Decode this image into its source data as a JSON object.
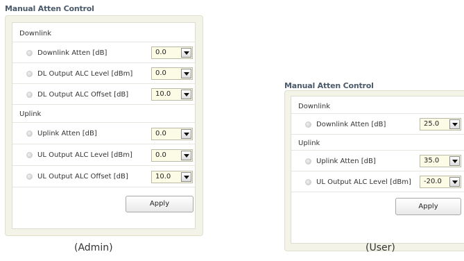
{
  "admin": {
    "title": "Manual Atten Control",
    "downlink_label": "Downlink",
    "uplink_label": "Uplink",
    "downlink_rows": [
      {
        "label": "Downlink Atten [dB]",
        "value": "0.0"
      },
      {
        "label": "DL Output ALC Level [dBm]",
        "value": "0.0"
      },
      {
        "label": "DL Output ALC Offset [dB]",
        "value": "10.0"
      }
    ],
    "uplink_rows": [
      {
        "label": "Uplink Atten [dB]",
        "value": "0.0"
      },
      {
        "label": "UL Output ALC Level [dBm]",
        "value": "0.0"
      },
      {
        "label": "UL Output ALC Offset [dB]",
        "value": "10.0"
      }
    ],
    "apply_label": "Apply",
    "caption": "(Admin)"
  },
  "user": {
    "title": "Manual Atten Control",
    "downlink_label": "Downlink",
    "uplink_label": "Uplink",
    "downlink_rows": [
      {
        "label": "Downlink Atten [dB]",
        "value": "25.0"
      }
    ],
    "uplink_rows": [
      {
        "label": "Uplink Atten [dB]",
        "value": "35.0"
      },
      {
        "label": "UL Output ALC Level [dBm]",
        "value": "-20.0"
      }
    ],
    "apply_label": "Apply",
    "caption": "(User)"
  },
  "icons": {
    "row_bullet": "radio-bullet-icon",
    "dropdown": "chevron-down-icon"
  }
}
